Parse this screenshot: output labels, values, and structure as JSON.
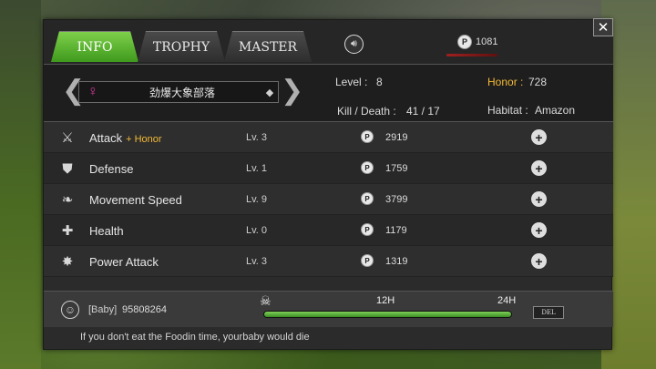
{
  "tabs": [
    {
      "label": "INFO",
      "active": true
    },
    {
      "label": "TROPHY",
      "active": false
    },
    {
      "label": "MASTER",
      "active": false
    }
  ],
  "header": {
    "sound_icon": "speaker-icon",
    "coin_symbol": "P",
    "coin_value": "1081",
    "close_symbol": "✕"
  },
  "profile": {
    "gender_symbol": "♀",
    "name": "劲爆大象部落",
    "diamond_symbol": "◆",
    "level_label": "Level :",
    "level_value": "8",
    "honor_label": "Honor :",
    "honor_value": "728",
    "kill_death_label": "Kill / Death :",
    "kill_death_value": "41  /  17",
    "habitat_label": "Habitat :",
    "habitat_value": "Amazon"
  },
  "skills": [
    {
      "icon": "claw-icon",
      "glyph": "⚔",
      "name": "Attack",
      "honor_tag": "+ Honor",
      "level": "Lv. 3",
      "cost": "2919"
    },
    {
      "icon": "shield-icon",
      "glyph": "⛊",
      "name": "Defense",
      "honor_tag": "",
      "level": "Lv. 1",
      "cost": "1759"
    },
    {
      "icon": "wing-icon",
      "glyph": "❧",
      "name": "Movement Speed",
      "honor_tag": "",
      "level": "Lv. 9",
      "cost": "3799"
    },
    {
      "icon": "plus-cross-icon",
      "glyph": "✚",
      "name": "Health",
      "honor_tag": "",
      "level": "Lv. 0",
      "cost": "1179"
    },
    {
      "icon": "burst-icon",
      "glyph": "✸",
      "name": "Power Attack",
      "honor_tag": "",
      "level": "Lv. 3",
      "cost": "1319"
    }
  ],
  "baby": {
    "label": "[Baby]",
    "id": "95808264",
    "tick_12": "12H",
    "tick_24": "24H",
    "food_progress": 1.0,
    "del_label": "DEL"
  },
  "warning_text": "If you don't eat the Foodin time, yourbaby would die",
  "colors": {
    "accent_green": "#5ab52c",
    "honor_gold": "#f3b936",
    "gender_pink": "#d8399a"
  }
}
